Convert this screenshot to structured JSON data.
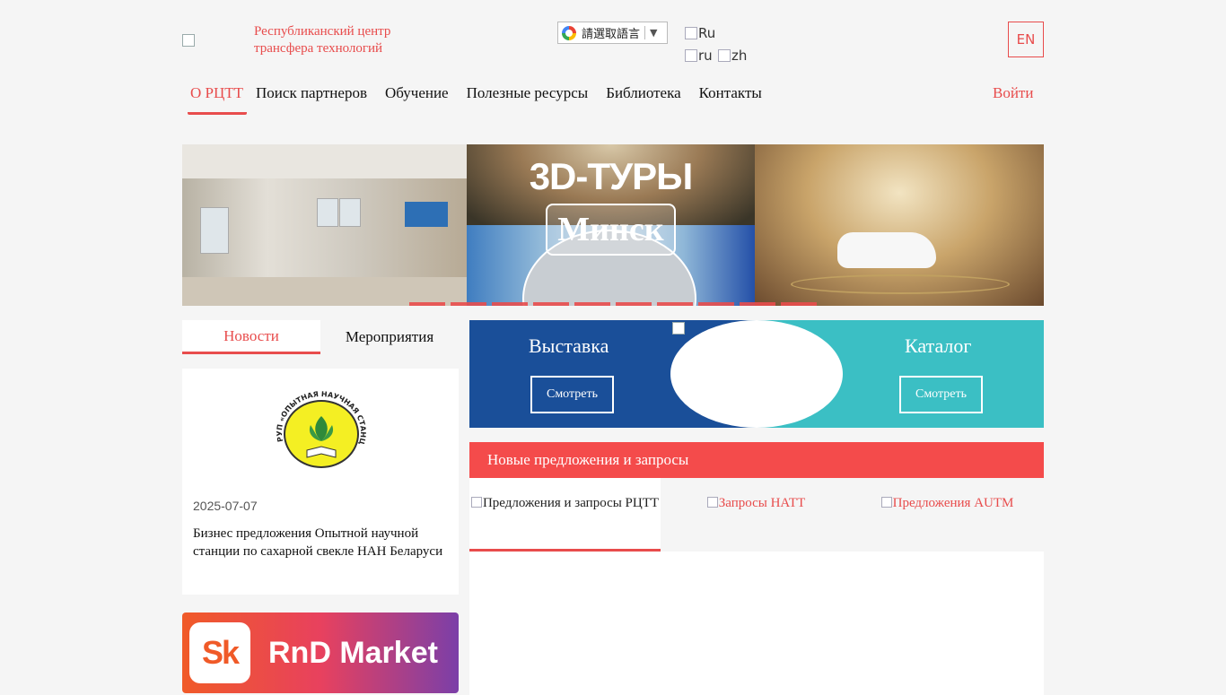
{
  "header": {
    "org_name_line1": "Республиканский центр",
    "org_name_line2": "трансфера технологий",
    "translate_label": "請選取語言",
    "translate_arrow": "▼",
    "flags": {
      "ru_caps": "Ru",
      "ru": "ru",
      "zh": "zh"
    },
    "lang_button": "EN"
  },
  "nav": {
    "items": [
      "О РЦТТ",
      "Поиск партнеров",
      "Обучение",
      "Полезные ресурсы",
      "Библиотека",
      "Контакты"
    ],
    "login": "Войти"
  },
  "banner": {
    "title": "3D-ТУРЫ",
    "subtitle": "Минск",
    "slides_count": 10
  },
  "left": {
    "tabs": [
      "Новости",
      "Мероприятия"
    ],
    "news": {
      "date": "2025-07-07",
      "title": "Бизнес предложения Опытной научной станции по сахарной свекле НАН Беларуси",
      "logo_text": "РУП «ОПЫТНАЯ НАУЧНАЯ СТАНЦИЯ ПО САХАРНОЙ СВЕКЛЕ»"
    },
    "promo": {
      "logo": "Sk",
      "text": "RnD Market"
    }
  },
  "right": {
    "expo": {
      "left_title": "Выставка",
      "left_button": "Смотреть",
      "right_title": "Каталог",
      "right_button": "Смотреть"
    },
    "offers": {
      "header": "Новые предложения и запросы",
      "tabs": [
        "Предложения и запросы РЦТТ",
        "Запросы НАТТ",
        "Предложения AUTM"
      ]
    }
  },
  "colors": {
    "accent": "#e84c4c",
    "expo_left": "#1a4f99",
    "expo_right": "#3bbfc4",
    "offers_header": "#f44b4b"
  }
}
